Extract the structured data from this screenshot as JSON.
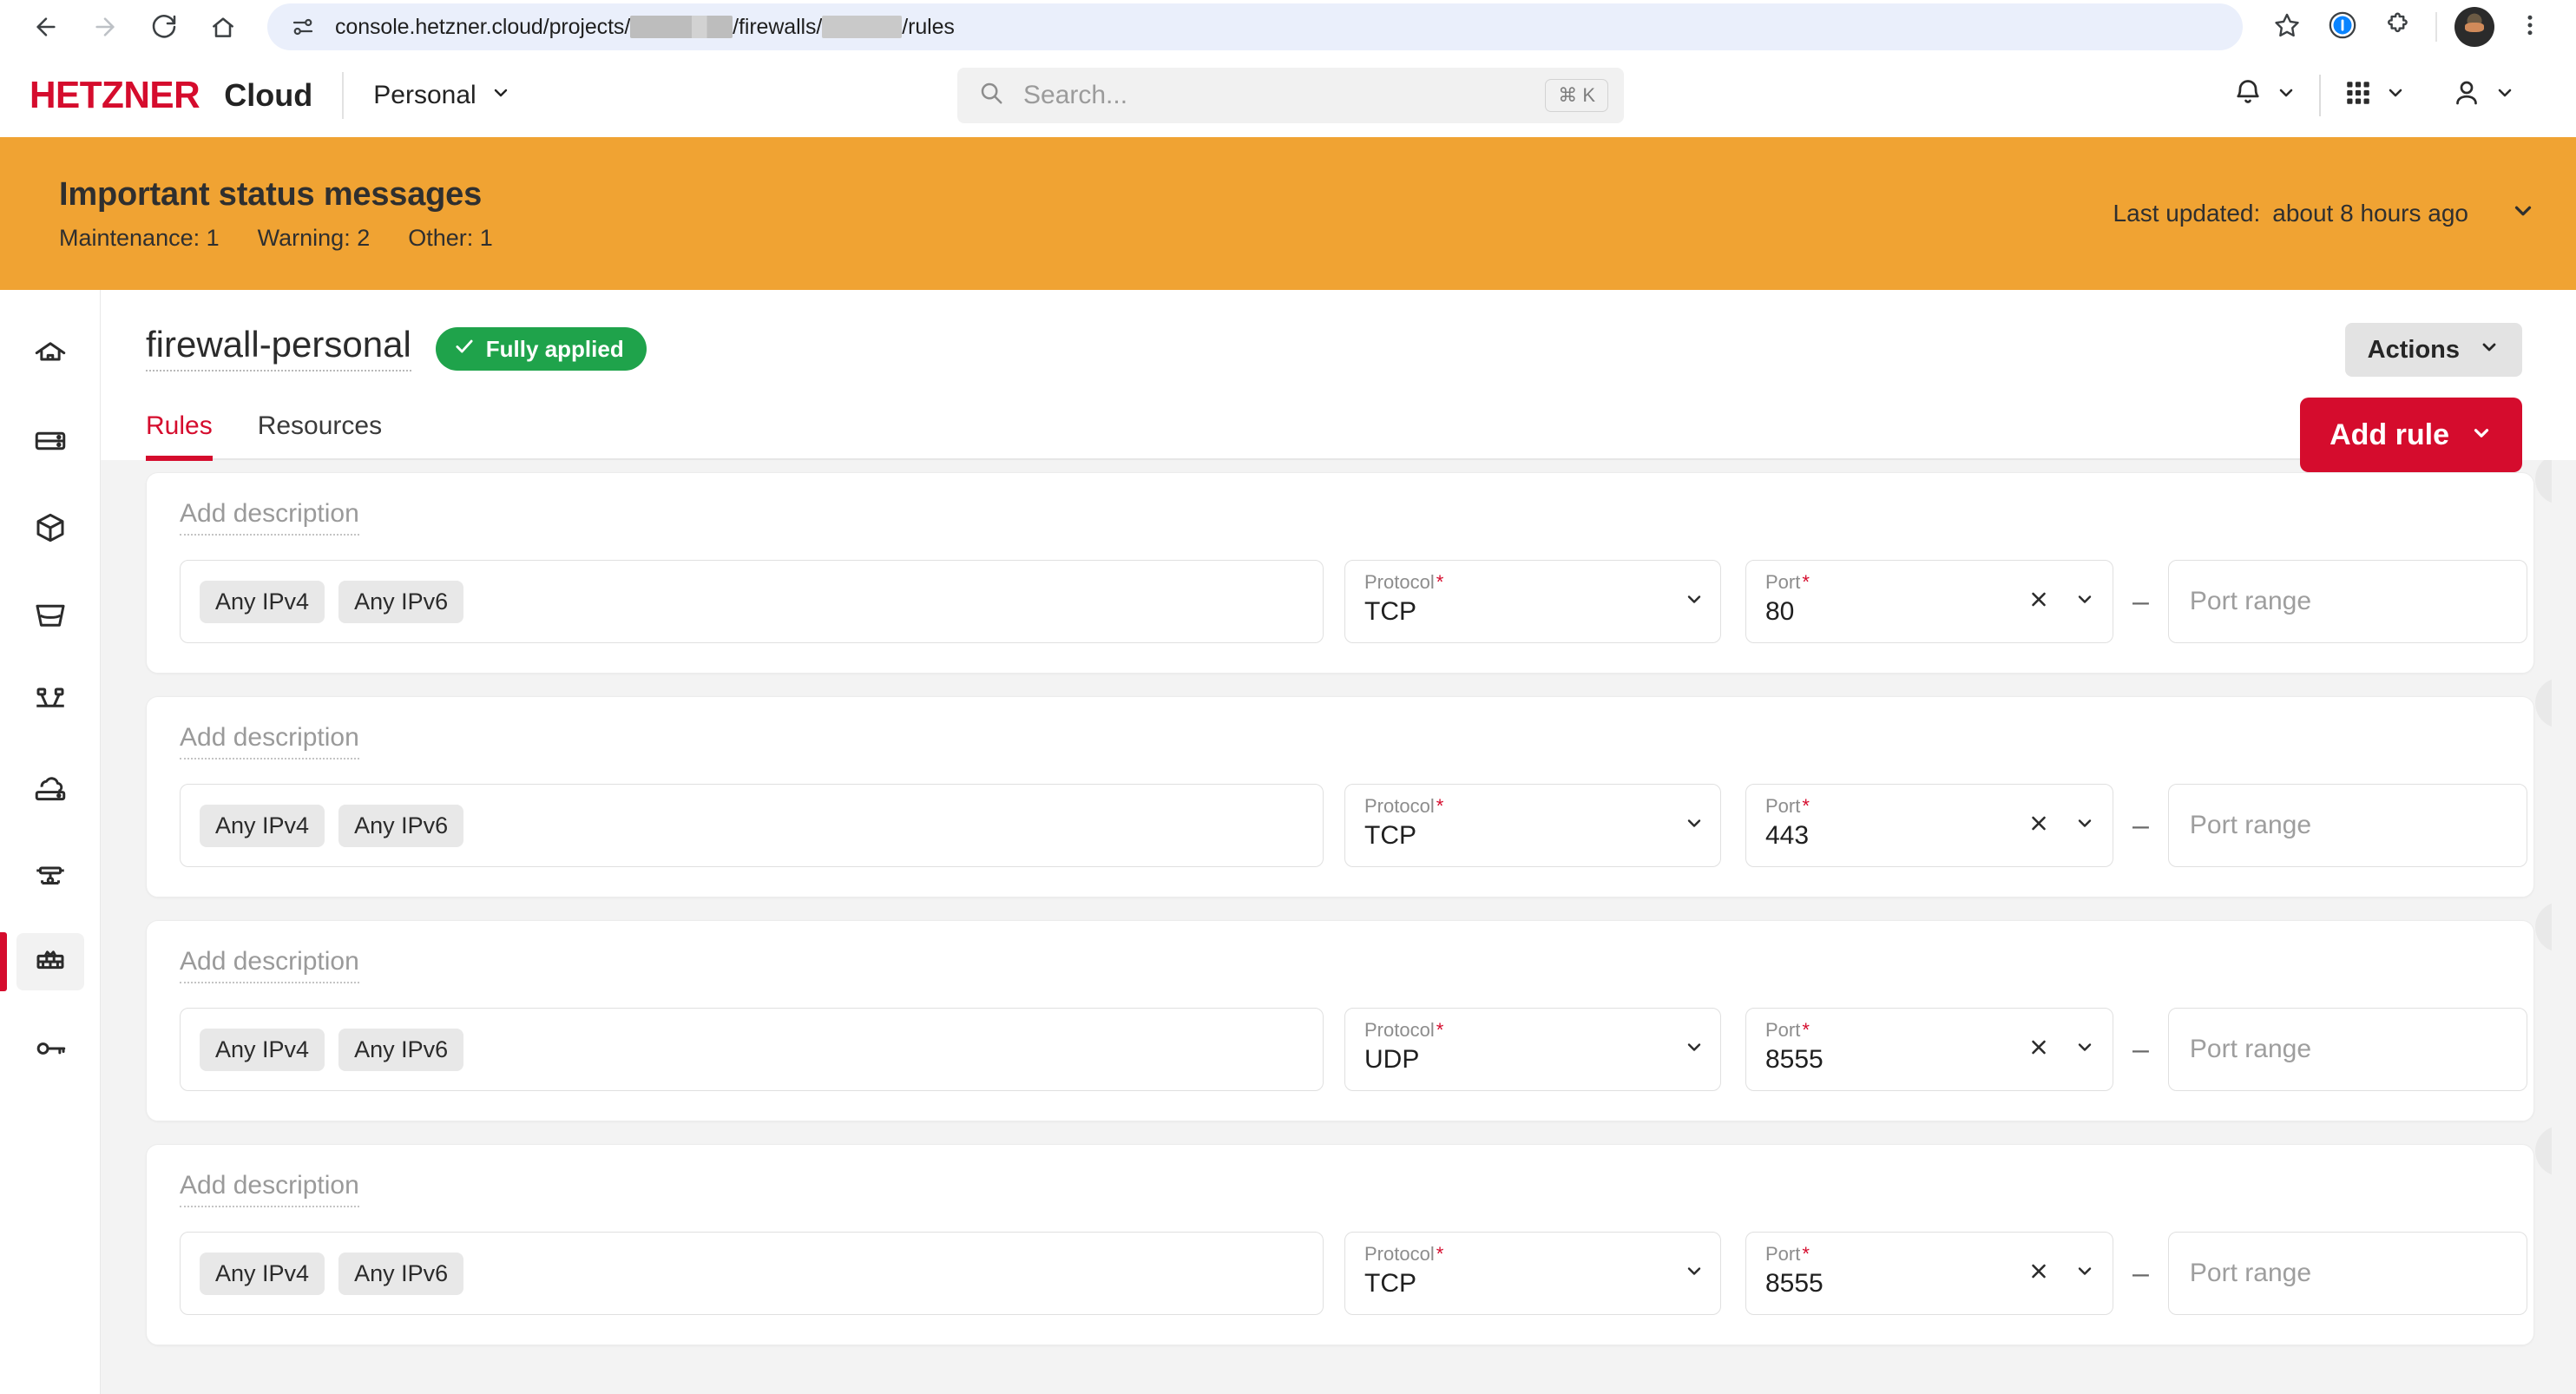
{
  "browser": {
    "back_icon": "back-arrow-icon",
    "forward_icon": "forward-arrow-icon",
    "reload_icon": "reload-icon",
    "home_icon": "home-icon",
    "site_info_icon": "site-settings-icon",
    "url_prefix": "console.hetzner.cloud/projects/",
    "url_middle": "/firewalls/",
    "url_suffix": "/rules",
    "bookmark_icon": "star-icon",
    "extension_1_icon": "1password-icon",
    "extension_2_icon": "puzzle-extension-icon",
    "profile_icon": "profile-avatar-icon",
    "menu_icon": "three-dot-menu-icon"
  },
  "header": {
    "logo": "HETZNER",
    "product": "Cloud",
    "project": "Personal",
    "project_chevron_icon": "chevron-down-icon",
    "search": {
      "placeholder": "Search...",
      "icon": "search-icon",
      "shortcut": "⌘ K"
    },
    "notifications_icon": "bell-icon",
    "apps_icon": "grid-apps-icon",
    "account_icon": "user-icon",
    "chevron_icon": "chevron-down-icon"
  },
  "banner": {
    "title": "Important status messages",
    "maintenance_label": "Maintenance:",
    "maintenance_count": "1",
    "warning_label": "Warning:",
    "warning_count": "2",
    "other_label": "Other:",
    "other_count": "1",
    "updated_label": "Last updated:",
    "updated_value": "about 8 hours ago",
    "expand_icon": "chevron-down-icon",
    "color": "#F0A333"
  },
  "sidebar": {
    "items": [
      {
        "name": "home",
        "icon": "home-icon",
        "active": false
      },
      {
        "name": "servers",
        "icon": "server-icon",
        "active": false
      },
      {
        "name": "volumes",
        "icon": "cube-icon",
        "active": false
      },
      {
        "name": "object-storage",
        "icon": "bucket-icon",
        "active": false
      },
      {
        "name": "load-balancers",
        "icon": "load-balancer-icon",
        "active": false
      },
      {
        "name": "cloud-servers",
        "icon": "cloud-server-icon",
        "active": false
      },
      {
        "name": "networks",
        "icon": "network-icon",
        "active": false
      },
      {
        "name": "firewalls",
        "icon": "firewall-brick-icon",
        "active": true
      },
      {
        "name": "security-keys",
        "icon": "key-icon",
        "active": false
      }
    ],
    "active_color": "#D50C2D"
  },
  "page": {
    "title": "firewall-personal",
    "status_badge": "Fully applied",
    "status_badge_icon": "check-icon",
    "status_badge_color": "#1FA34B",
    "tabs": [
      {
        "label": "Rules",
        "active": true
      },
      {
        "label": "Resources",
        "active": false
      }
    ],
    "actions_button": "Actions",
    "actions_chevron_icon": "chevron-down-icon",
    "add_rule_button": "Add rule",
    "add_rule_chevron_icon": "chevron-down-icon",
    "add_rule_color": "#D50C2D"
  },
  "rules": {
    "description_placeholder": "Add description",
    "protocol_label": "Protocol",
    "port_label": "Port",
    "port_range_placeholder": "Port range",
    "required_marker": "*",
    "range_dash": "–",
    "clear_icon": "clear-x-icon",
    "chevron_icon": "chevron-down-icon",
    "remove_icon": "close-x-icon",
    "items": [
      {
        "description": "",
        "sources": [
          "Any IPv4",
          "Any IPv6"
        ],
        "protocol": "TCP",
        "port": "80",
        "port_range": ""
      },
      {
        "description": "",
        "sources": [
          "Any IPv4",
          "Any IPv6"
        ],
        "protocol": "TCP",
        "port": "443",
        "port_range": ""
      },
      {
        "description": "",
        "sources": [
          "Any IPv4",
          "Any IPv6"
        ],
        "protocol": "UDP",
        "port": "8555",
        "port_range": ""
      },
      {
        "description": "",
        "sources": [
          "Any IPv4",
          "Any IPv6"
        ],
        "protocol": "TCP",
        "port": "8555",
        "port_range": ""
      }
    ]
  }
}
